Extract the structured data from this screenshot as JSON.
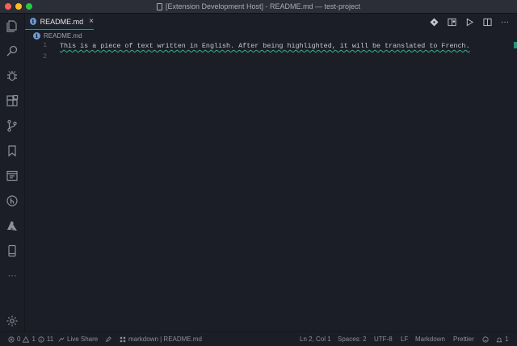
{
  "window": {
    "title": "[Extension Development Host] - README.md — test-project"
  },
  "tabs": [
    {
      "label": "README.md",
      "close_glyph": "×",
      "icon": "info-icon"
    }
  ],
  "breadcrumb": {
    "label": "README.md",
    "icon": "info-icon"
  },
  "editor": {
    "line_numbers": [
      "1",
      "2"
    ],
    "lines": [
      "This is a piece of text written in English. After being highlighted, it will be translated to French."
    ]
  },
  "editor_actions": {
    "more_glyph": "···"
  },
  "activity_bar": {
    "items": [
      "explorer-icon",
      "search-icon",
      "debug-icon",
      "extensions-icon",
      "source-control-icon",
      "bookmark-icon",
      "browser-icon",
      "git-graph-icon",
      "azure-icon",
      "device-icon",
      "more-icon"
    ],
    "more_glyph": "···",
    "bottom": "gear-icon"
  },
  "statusbar": {
    "errors": "0",
    "warnings": "1",
    "info": "11",
    "live_share": "Live Share",
    "language_mode_indicator": "markdown | README.md",
    "cursor_position": "Ln 2, Col 1",
    "spaces": "Spaces: 2",
    "encoding": "UTF-8",
    "eol": "LF",
    "language": "Markdown",
    "formatter": "Prettier",
    "notifications": "1"
  },
  "colors": {
    "accent": "#e2445a",
    "squiggle": "#3fae8c",
    "info": "#6b9ad4"
  }
}
